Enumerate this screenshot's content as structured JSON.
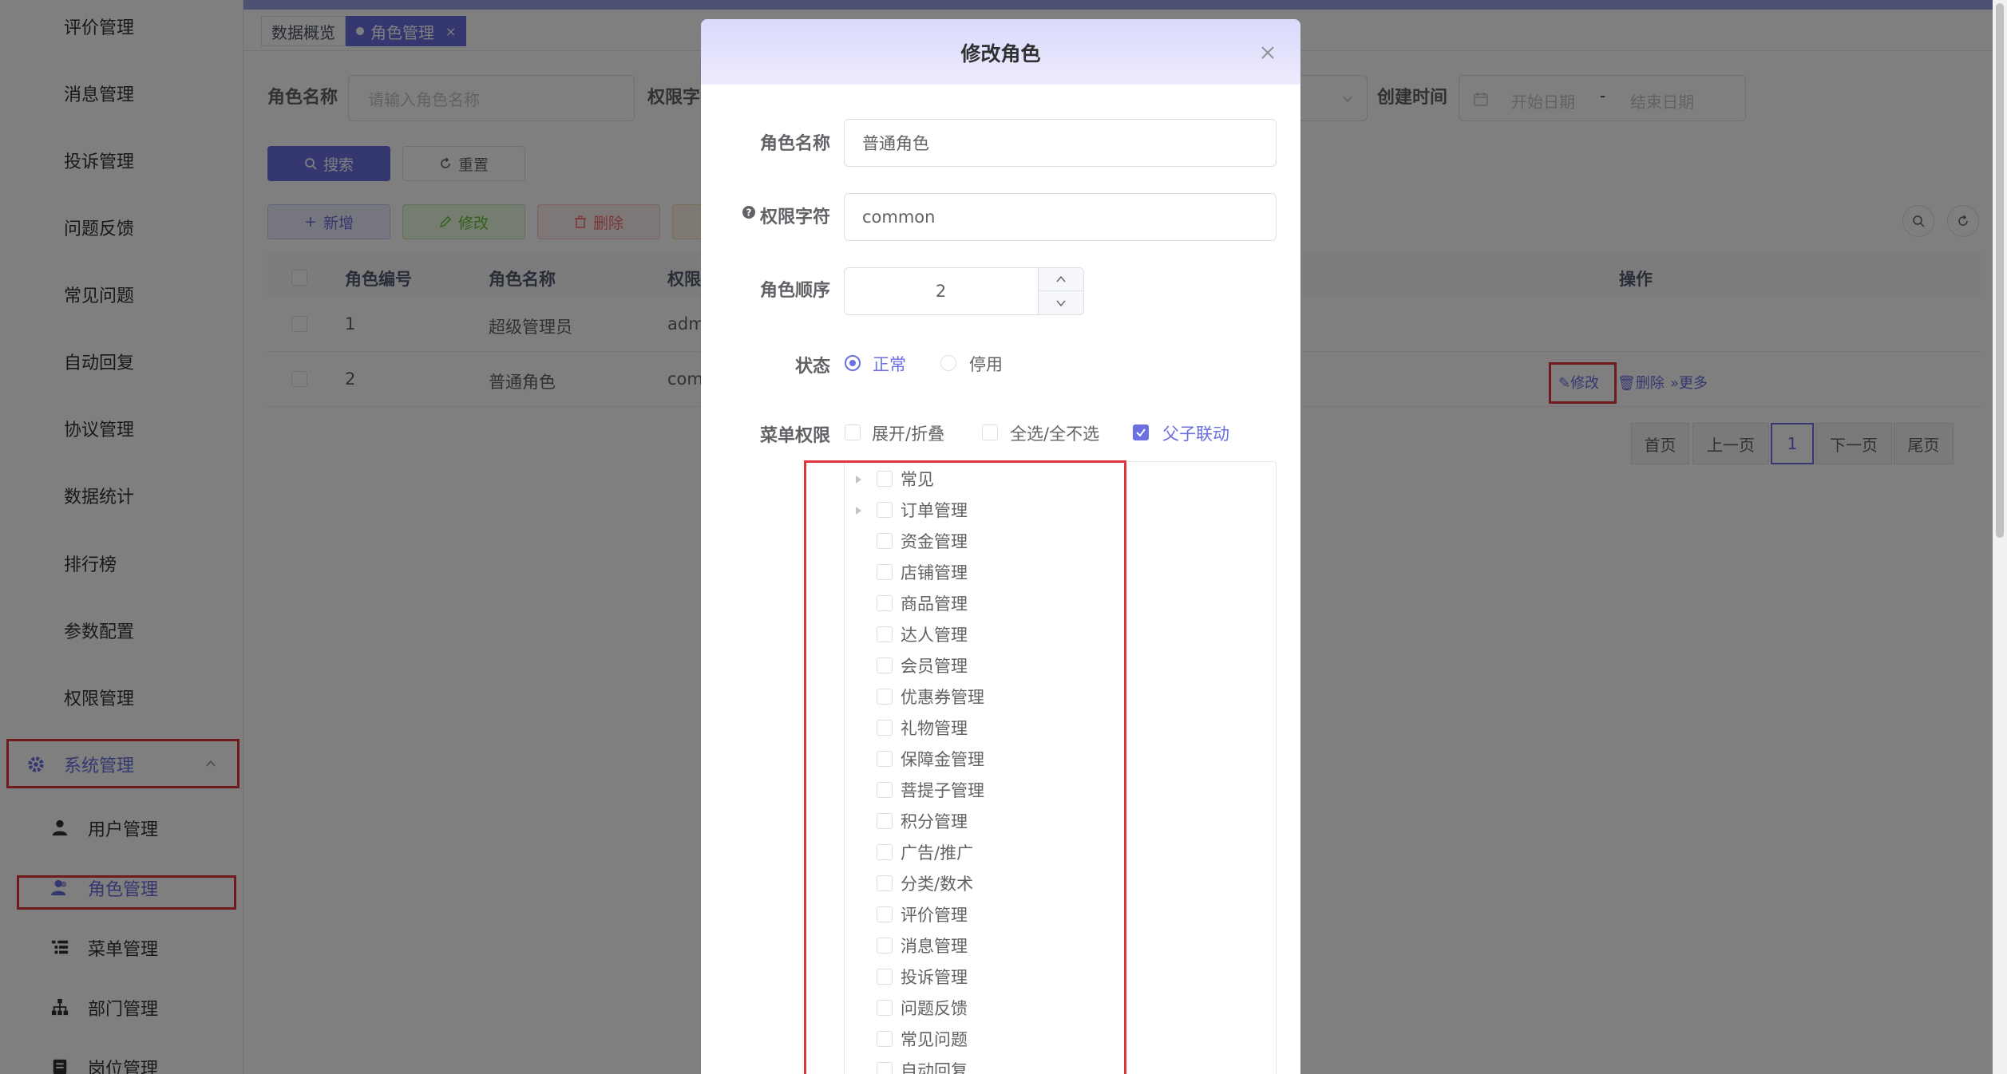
{
  "sidebar": {
    "items": [
      "评价管理",
      "消息管理",
      "投诉管理",
      "问题反馈",
      "常见问题",
      "自动回复",
      "协议管理",
      "数据统计",
      "排行榜",
      "参数配置",
      "权限管理"
    ],
    "group_label": "系统管理",
    "sub_items": [
      "用户管理",
      "角色管理",
      "菜单管理",
      "部门管理",
      "岗位管理"
    ]
  },
  "tags": {
    "overview": "数据概览",
    "current": "角色管理",
    "close": "×"
  },
  "search": {
    "role_name_label": "角色名称",
    "role_name_placeholder": "请输入角色名称",
    "perm_label": "权限字符",
    "create_time_label": "创建时间",
    "start_placeholder": "开始日期",
    "date_sep": "-",
    "end_placeholder": "结束日期",
    "search_btn": "搜索",
    "reset_btn": "重置"
  },
  "toolbar": {
    "add": "新增",
    "edit": "修改",
    "delete": "删除"
  },
  "table": {
    "headers": [
      "角色编号",
      "角色名称",
      "权限",
      "操作"
    ],
    "rows": [
      {
        "id": "1",
        "name": "超级管理员",
        "perm": "adm"
      },
      {
        "id": "2",
        "name": "普通角色",
        "perm": "com"
      }
    ],
    "actions": {
      "edit": "修改",
      "delete": "删除",
      "more": "更多"
    }
  },
  "pagination": {
    "first": "首页",
    "prev": "上一页",
    "current": "1",
    "next": "下一页",
    "last": "尾页"
  },
  "dialog": {
    "title": "修改角色",
    "role_name_label": "角色名称",
    "role_name_value": "普通角色",
    "perm_label": "权限字符",
    "perm_value": "common",
    "order_label": "角色顺序",
    "order_value": "2",
    "status_label": "状态",
    "status_normal": "正常",
    "status_disabled": "停用",
    "menu_label": "菜单权限",
    "expand_collapse": "展开/折叠",
    "select_all": "全选/全不选",
    "parent_child": "父子联动",
    "tree": [
      "常见",
      "订单管理",
      "资金管理",
      "店铺管理",
      "商品管理",
      "达人管理",
      "会员管理",
      "优惠券管理",
      "礼物管理",
      "保障金管理",
      "菩提子管理",
      "积分管理",
      "广告/推广",
      "分类/数术",
      "评价管理",
      "消息管理",
      "投诉管理",
      "问题反馈",
      "常见问题",
      "自动回复"
    ]
  },
  "colors": {
    "accent": "#6b6fe0",
    "highlight_box": "#e0343a"
  }
}
